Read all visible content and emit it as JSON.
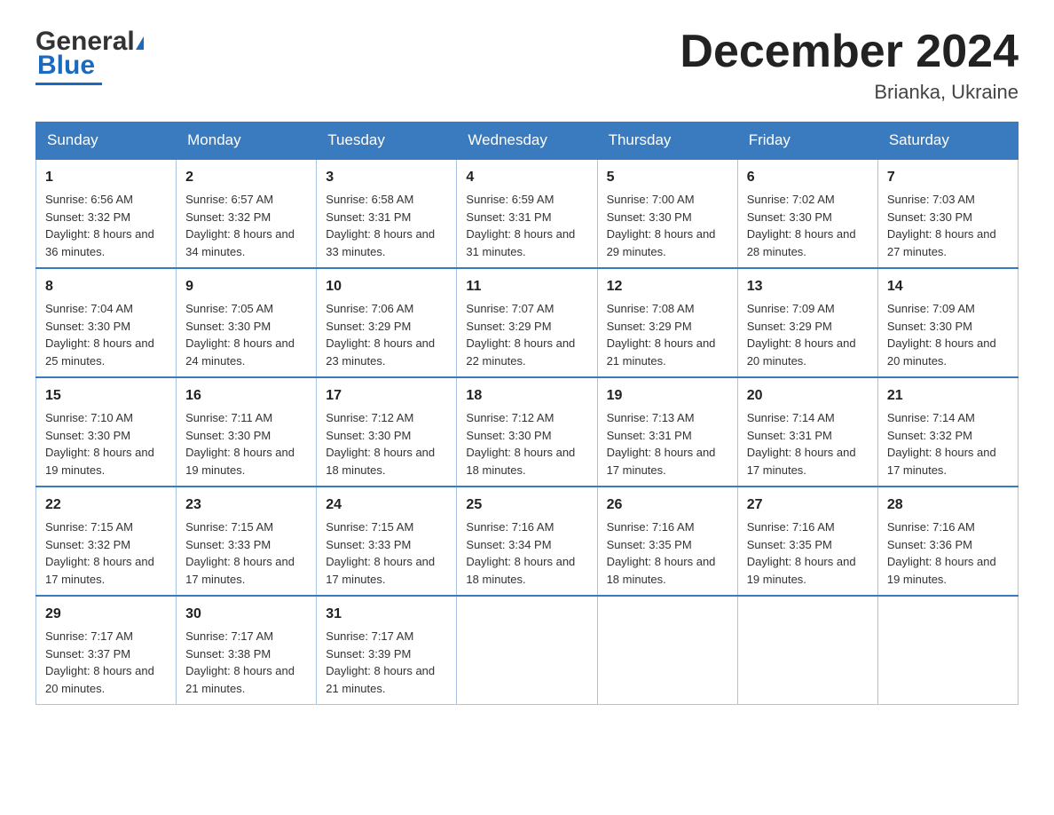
{
  "header": {
    "logo_general": "General",
    "logo_blue": "Blue",
    "month_title": "December 2024",
    "location": "Brianka, Ukraine"
  },
  "days_of_week": [
    "Sunday",
    "Monday",
    "Tuesday",
    "Wednesday",
    "Thursday",
    "Friday",
    "Saturday"
  ],
  "weeks": [
    [
      {
        "day": "1",
        "sunrise": "6:56 AM",
        "sunset": "3:32 PM",
        "daylight": "8 hours and 36 minutes."
      },
      {
        "day": "2",
        "sunrise": "6:57 AM",
        "sunset": "3:32 PM",
        "daylight": "8 hours and 34 minutes."
      },
      {
        "day": "3",
        "sunrise": "6:58 AM",
        "sunset": "3:31 PM",
        "daylight": "8 hours and 33 minutes."
      },
      {
        "day": "4",
        "sunrise": "6:59 AM",
        "sunset": "3:31 PM",
        "daylight": "8 hours and 31 minutes."
      },
      {
        "day": "5",
        "sunrise": "7:00 AM",
        "sunset": "3:30 PM",
        "daylight": "8 hours and 29 minutes."
      },
      {
        "day": "6",
        "sunrise": "7:02 AM",
        "sunset": "3:30 PM",
        "daylight": "8 hours and 28 minutes."
      },
      {
        "day": "7",
        "sunrise": "7:03 AM",
        "sunset": "3:30 PM",
        "daylight": "8 hours and 27 minutes."
      }
    ],
    [
      {
        "day": "8",
        "sunrise": "7:04 AM",
        "sunset": "3:30 PM",
        "daylight": "8 hours and 25 minutes."
      },
      {
        "day": "9",
        "sunrise": "7:05 AM",
        "sunset": "3:30 PM",
        "daylight": "8 hours and 24 minutes."
      },
      {
        "day": "10",
        "sunrise": "7:06 AM",
        "sunset": "3:29 PM",
        "daylight": "8 hours and 23 minutes."
      },
      {
        "day": "11",
        "sunrise": "7:07 AM",
        "sunset": "3:29 PM",
        "daylight": "8 hours and 22 minutes."
      },
      {
        "day": "12",
        "sunrise": "7:08 AM",
        "sunset": "3:29 PM",
        "daylight": "8 hours and 21 minutes."
      },
      {
        "day": "13",
        "sunrise": "7:09 AM",
        "sunset": "3:29 PM",
        "daylight": "8 hours and 20 minutes."
      },
      {
        "day": "14",
        "sunrise": "7:09 AM",
        "sunset": "3:30 PM",
        "daylight": "8 hours and 20 minutes."
      }
    ],
    [
      {
        "day": "15",
        "sunrise": "7:10 AM",
        "sunset": "3:30 PM",
        "daylight": "8 hours and 19 minutes."
      },
      {
        "day": "16",
        "sunrise": "7:11 AM",
        "sunset": "3:30 PM",
        "daylight": "8 hours and 19 minutes."
      },
      {
        "day": "17",
        "sunrise": "7:12 AM",
        "sunset": "3:30 PM",
        "daylight": "8 hours and 18 minutes."
      },
      {
        "day": "18",
        "sunrise": "7:12 AM",
        "sunset": "3:30 PM",
        "daylight": "8 hours and 18 minutes."
      },
      {
        "day": "19",
        "sunrise": "7:13 AM",
        "sunset": "3:31 PM",
        "daylight": "8 hours and 17 minutes."
      },
      {
        "day": "20",
        "sunrise": "7:14 AM",
        "sunset": "3:31 PM",
        "daylight": "8 hours and 17 minutes."
      },
      {
        "day": "21",
        "sunrise": "7:14 AM",
        "sunset": "3:32 PM",
        "daylight": "8 hours and 17 minutes."
      }
    ],
    [
      {
        "day": "22",
        "sunrise": "7:15 AM",
        "sunset": "3:32 PM",
        "daylight": "8 hours and 17 minutes."
      },
      {
        "day": "23",
        "sunrise": "7:15 AM",
        "sunset": "3:33 PM",
        "daylight": "8 hours and 17 minutes."
      },
      {
        "day": "24",
        "sunrise": "7:15 AM",
        "sunset": "3:33 PM",
        "daylight": "8 hours and 17 minutes."
      },
      {
        "day": "25",
        "sunrise": "7:16 AM",
        "sunset": "3:34 PM",
        "daylight": "8 hours and 18 minutes."
      },
      {
        "day": "26",
        "sunrise": "7:16 AM",
        "sunset": "3:35 PM",
        "daylight": "8 hours and 18 minutes."
      },
      {
        "day": "27",
        "sunrise": "7:16 AM",
        "sunset": "3:35 PM",
        "daylight": "8 hours and 19 minutes."
      },
      {
        "day": "28",
        "sunrise": "7:16 AM",
        "sunset": "3:36 PM",
        "daylight": "8 hours and 19 minutes."
      }
    ],
    [
      {
        "day": "29",
        "sunrise": "7:17 AM",
        "sunset": "3:37 PM",
        "daylight": "8 hours and 20 minutes."
      },
      {
        "day": "30",
        "sunrise": "7:17 AM",
        "sunset": "3:38 PM",
        "daylight": "8 hours and 21 minutes."
      },
      {
        "day": "31",
        "sunrise": "7:17 AM",
        "sunset": "3:39 PM",
        "daylight": "8 hours and 21 minutes."
      },
      null,
      null,
      null,
      null
    ]
  ],
  "labels": {
    "sunrise": "Sunrise:",
    "sunset": "Sunset:",
    "daylight": "Daylight:"
  }
}
